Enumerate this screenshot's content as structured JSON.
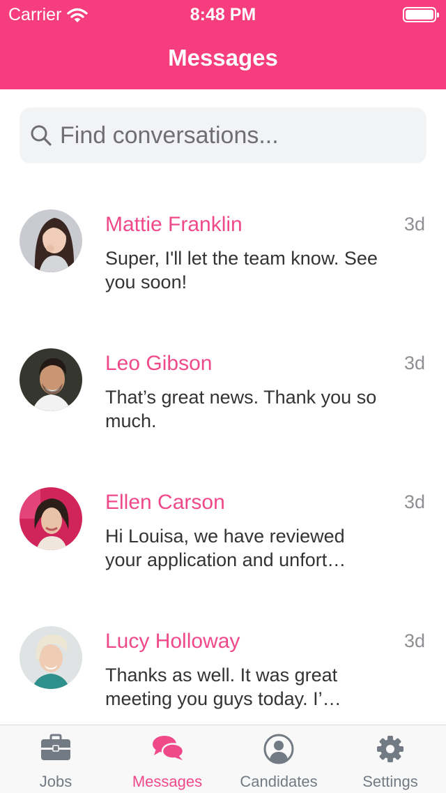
{
  "status_bar": {
    "carrier": "Carrier",
    "time": "8:48 PM"
  },
  "nav": {
    "title": "Messages"
  },
  "search": {
    "placeholder": "Find conversations..."
  },
  "conversations": [
    {
      "name": "Mattie Franklin",
      "ago": "3d",
      "preview": "Super, I'll let the team know. See you soon!"
    },
    {
      "name": "Leo Gibson",
      "ago": "3d",
      "preview": "That’s great news. Thank you so much."
    },
    {
      "name": "Ellen Carson",
      "ago": "3d",
      "preview": "Hi Louisa, we have reviewed your application and unfort…"
    },
    {
      "name": "Lucy Holloway",
      "ago": "3d",
      "preview": "Thanks as well. It was great meeting you guys today. I’…"
    }
  ],
  "tabs": [
    {
      "label": "Jobs",
      "icon": "briefcase-icon"
    },
    {
      "label": "Messages",
      "icon": "chat-bubbles-icon"
    },
    {
      "label": "Candidates",
      "icon": "user-circle-icon"
    },
    {
      "label": "Settings",
      "icon": "gear-icon"
    }
  ],
  "colors": {
    "brand": "#f63d7d",
    "accent_text": "#f0498a",
    "inactive_tab": "#727a84"
  }
}
